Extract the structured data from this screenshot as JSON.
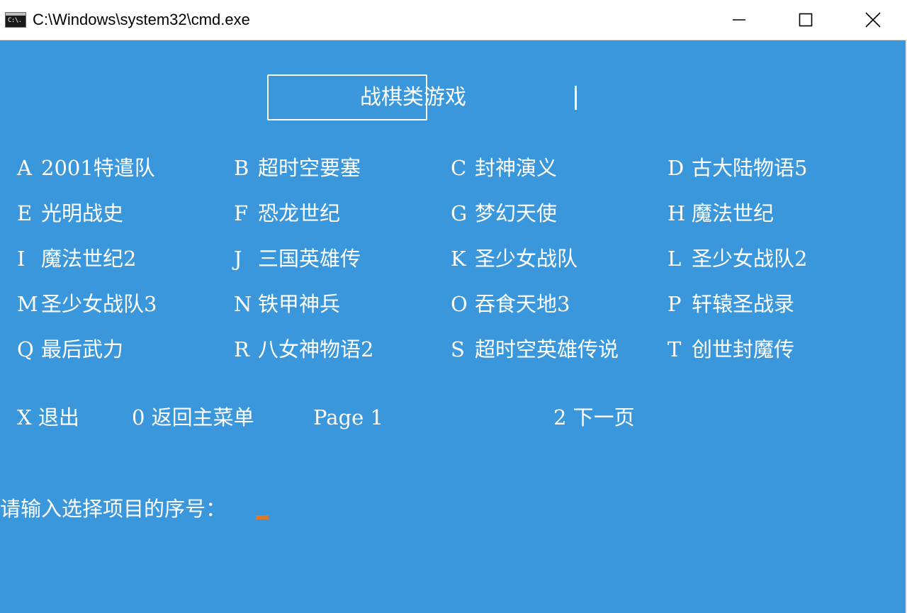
{
  "window": {
    "title": "C:\\Windows\\system32\\cmd.exe",
    "icon_text": "C:\\.",
    "controls": [
      "minimize-icon",
      "maximize-icon",
      "close-icon"
    ]
  },
  "colors": {
    "console_background": "#3b97db",
    "console_text": "#ffffff",
    "cursor": "#d9782e"
  },
  "console": {
    "heading": "战棋类游戏",
    "menu": [
      {
        "key": "A",
        "label": "2001特遣队"
      },
      {
        "key": "B",
        "label": "超时空要塞"
      },
      {
        "key": "C",
        "label": "封神演义"
      },
      {
        "key": "D",
        "label": "古大陆物语5"
      },
      {
        "key": "E",
        "label": "光明战史"
      },
      {
        "key": "F",
        "label": "恐龙世纪"
      },
      {
        "key": "G",
        "label": "梦幻天使"
      },
      {
        "key": "H",
        "label": "魔法世纪"
      },
      {
        "key": "I",
        "label": "魔法世纪2"
      },
      {
        "key": "J",
        "label": "三国英雄传"
      },
      {
        "key": "K",
        "label": "圣少女战队"
      },
      {
        "key": "L",
        "label": "圣少女战队2"
      },
      {
        "key": "M",
        "label": "圣少女战队3"
      },
      {
        "key": "N",
        "label": "铁甲神兵"
      },
      {
        "key": "O",
        "label": "吞食天地3"
      },
      {
        "key": "P",
        "label": "轩辕圣战录"
      },
      {
        "key": "Q",
        "label": "最后武力"
      },
      {
        "key": "R",
        "label": "八女神物语2"
      },
      {
        "key": "S",
        "label": "超时空英雄传说"
      },
      {
        "key": "T",
        "label": "创世封魔传"
      }
    ],
    "footer": {
      "exit": "X 退出",
      "back": "0 返回主菜单",
      "page": "Page 1",
      "next": "2 下一页"
    },
    "prompt": "请输入选择项目的序号："
  }
}
